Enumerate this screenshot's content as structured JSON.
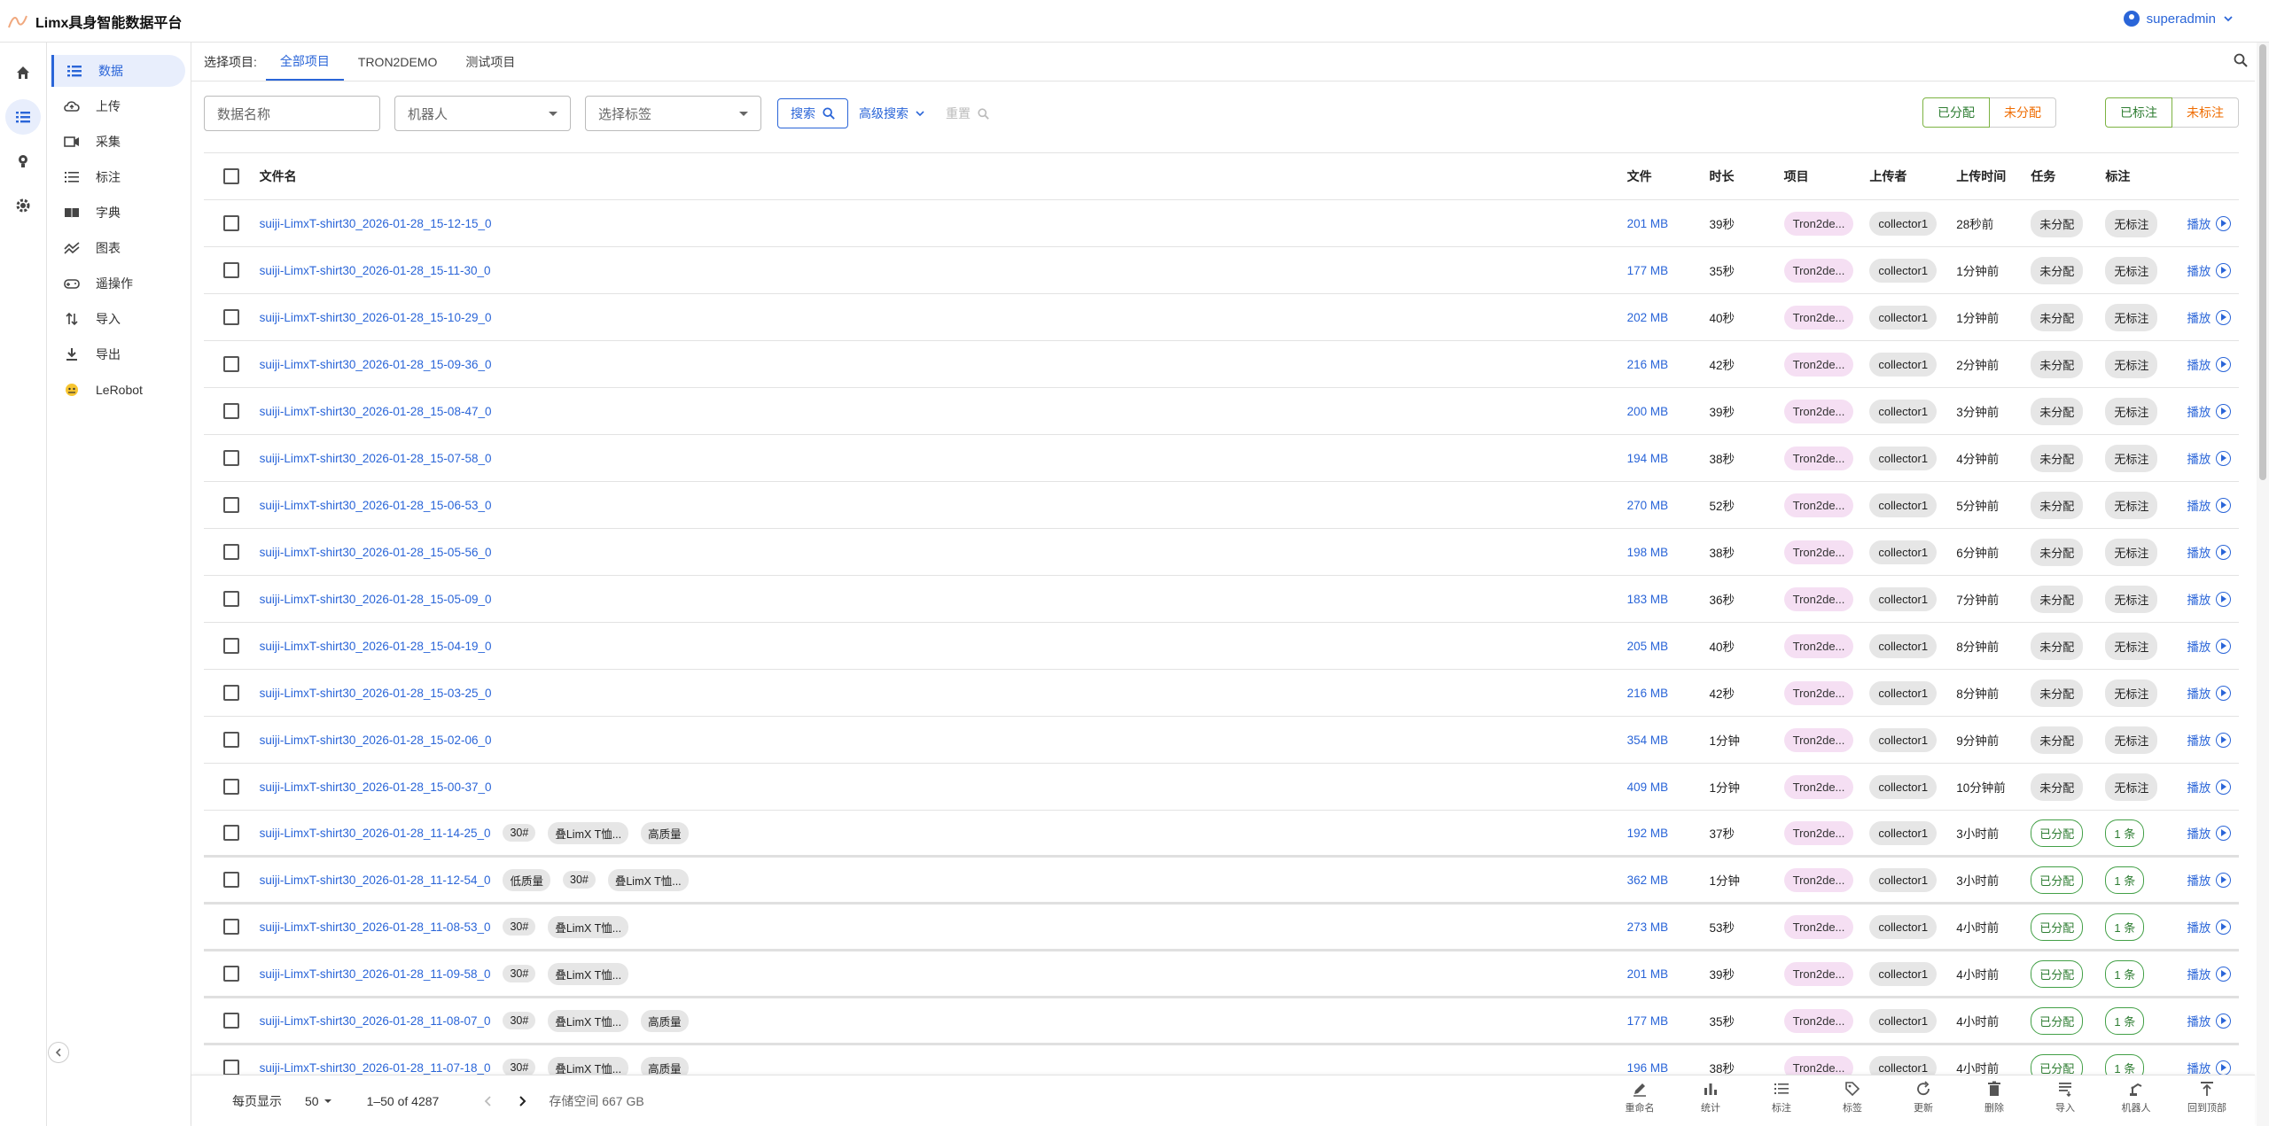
{
  "app": {
    "title": "Limx具身智能数据平台"
  },
  "user": {
    "name": "superadmin"
  },
  "colors": {
    "accent": "#2a65d8",
    "green": "#2e7d32",
    "orange": "#ef6c00",
    "chip_project": "#f5dff3"
  },
  "rail": [
    {
      "icon": "home-icon"
    },
    {
      "icon": "list-icon",
      "active": true
    },
    {
      "icon": "bulb-icon"
    },
    {
      "icon": "gear-icon"
    }
  ],
  "nav": [
    {
      "label": "数据",
      "icon": "list-icon",
      "active": true
    },
    {
      "label": "上传",
      "icon": "cloud-upload-icon"
    },
    {
      "label": "采集",
      "icon": "camera-icon"
    },
    {
      "label": "标注",
      "icon": "checklist-icon"
    },
    {
      "label": "字典",
      "icon": "book-icon"
    },
    {
      "label": "图表",
      "icon": "chart-line-icon"
    },
    {
      "label": "遥操作",
      "icon": "gamepad-icon"
    },
    {
      "label": "导入",
      "icon": "swap-vertical-icon"
    },
    {
      "label": "导出",
      "icon": "download-icon"
    },
    {
      "label": "LeRobot",
      "icon": "robot-emoji-icon"
    }
  ],
  "projects": {
    "label": "选择项目:",
    "tabs": [
      "全部项目",
      "TRON2DEMO",
      "测试项目"
    ],
    "active": 0
  },
  "filters": {
    "name_placeholder": "数据名称",
    "robot_placeholder": "机器人",
    "tag_placeholder": "选择标签",
    "search_label": "搜索",
    "advanced_label": "高级搜索",
    "reset_label": "重置",
    "assign": {
      "assigned": "已分配",
      "unassigned": "未分配"
    },
    "label": {
      "labeled": "已标注",
      "unlabeled": "未标注"
    }
  },
  "table": {
    "columns": {
      "name": "文件名",
      "size": "文件",
      "duration": "时长",
      "project": "项目",
      "uploader": "上传者",
      "time": "上传时间",
      "task": "任务",
      "label": "标注"
    },
    "play_label": "播放",
    "rows": [
      {
        "name": "suiji-LimxT-shirt30_2026-01-28_15-12-15_0",
        "tags": [],
        "size": "201 MB",
        "duration": "39秒",
        "project": "Tron2de...",
        "uploader": "collector1",
        "time": "28秒前",
        "task": "未分配",
        "label": "无标注",
        "done": false
      },
      {
        "name": "suiji-LimxT-shirt30_2026-01-28_15-11-30_0",
        "tags": [],
        "size": "177 MB",
        "duration": "35秒",
        "project": "Tron2de...",
        "uploader": "collector1",
        "time": "1分钟前",
        "task": "未分配",
        "label": "无标注",
        "done": false
      },
      {
        "name": "suiji-LimxT-shirt30_2026-01-28_15-10-29_0",
        "tags": [],
        "size": "202 MB",
        "duration": "40秒",
        "project": "Tron2de...",
        "uploader": "collector1",
        "time": "1分钟前",
        "task": "未分配",
        "label": "无标注",
        "done": false
      },
      {
        "name": "suiji-LimxT-shirt30_2026-01-28_15-09-36_0",
        "tags": [],
        "size": "216 MB",
        "duration": "42秒",
        "project": "Tron2de...",
        "uploader": "collector1",
        "time": "2分钟前",
        "task": "未分配",
        "label": "无标注",
        "done": false
      },
      {
        "name": "suiji-LimxT-shirt30_2026-01-28_15-08-47_0",
        "tags": [],
        "size": "200 MB",
        "duration": "39秒",
        "project": "Tron2de...",
        "uploader": "collector1",
        "time": "3分钟前",
        "task": "未分配",
        "label": "无标注",
        "done": false
      },
      {
        "name": "suiji-LimxT-shirt30_2026-01-28_15-07-58_0",
        "tags": [],
        "size": "194 MB",
        "duration": "38秒",
        "project": "Tron2de...",
        "uploader": "collector1",
        "time": "4分钟前",
        "task": "未分配",
        "label": "无标注",
        "done": false
      },
      {
        "name": "suiji-LimxT-shirt30_2026-01-28_15-06-53_0",
        "tags": [],
        "size": "270 MB",
        "duration": "52秒",
        "project": "Tron2de...",
        "uploader": "collector1",
        "time": "5分钟前",
        "task": "未分配",
        "label": "无标注",
        "done": false
      },
      {
        "name": "suiji-LimxT-shirt30_2026-01-28_15-05-56_0",
        "tags": [],
        "size": "198 MB",
        "duration": "38秒",
        "project": "Tron2de...",
        "uploader": "collector1",
        "time": "6分钟前",
        "task": "未分配",
        "label": "无标注",
        "done": false
      },
      {
        "name": "suiji-LimxT-shirt30_2026-01-28_15-05-09_0",
        "tags": [],
        "size": "183 MB",
        "duration": "36秒",
        "project": "Tron2de...",
        "uploader": "collector1",
        "time": "7分钟前",
        "task": "未分配",
        "label": "无标注",
        "done": false
      },
      {
        "name": "suiji-LimxT-shirt30_2026-01-28_15-04-19_0",
        "tags": [],
        "size": "205 MB",
        "duration": "40秒",
        "project": "Tron2de...",
        "uploader": "collector1",
        "time": "8分钟前",
        "task": "未分配",
        "label": "无标注",
        "done": false
      },
      {
        "name": "suiji-LimxT-shirt30_2026-01-28_15-03-25_0",
        "tags": [],
        "size": "216 MB",
        "duration": "42秒",
        "project": "Tron2de...",
        "uploader": "collector1",
        "time": "8分钟前",
        "task": "未分配",
        "label": "无标注",
        "done": false
      },
      {
        "name": "suiji-LimxT-shirt30_2026-01-28_15-02-06_0",
        "tags": [],
        "size": "354 MB",
        "duration": "1分钟",
        "project": "Tron2de...",
        "uploader": "collector1",
        "time": "9分钟前",
        "task": "未分配",
        "label": "无标注",
        "done": false
      },
      {
        "name": "suiji-LimxT-shirt30_2026-01-28_15-00-37_0",
        "tags": [],
        "size": "409 MB",
        "duration": "1分钟",
        "project": "Tron2de...",
        "uploader": "collector1",
        "time": "10分钟前",
        "task": "未分配",
        "label": "无标注",
        "done": false
      },
      {
        "name": "suiji-LimxT-shirt30_2026-01-28_11-14-25_0",
        "tags": [
          "30#",
          "叠LimX T恤...",
          "高质量"
        ],
        "size": "192 MB",
        "duration": "37秒",
        "project": "Tron2de...",
        "uploader": "collector1",
        "time": "3小时前",
        "task": "已分配",
        "label": "1 条",
        "done": true
      },
      {
        "name": "suiji-LimxT-shirt30_2026-01-28_11-12-54_0",
        "tags": [
          "低质量",
          "30#",
          "叠LimX T恤..."
        ],
        "size": "362 MB",
        "duration": "1分钟",
        "project": "Tron2de...",
        "uploader": "collector1",
        "time": "3小时前",
        "task": "已分配",
        "label": "1 条",
        "done": true
      },
      {
        "name": "suiji-LimxT-shirt30_2026-01-28_11-08-53_0",
        "tags": [
          "30#",
          "叠LimX T恤..."
        ],
        "size": "273 MB",
        "duration": "53秒",
        "project": "Tron2de...",
        "uploader": "collector1",
        "time": "4小时前",
        "task": "已分配",
        "label": "1 条",
        "done": true
      },
      {
        "name": "suiji-LimxT-shirt30_2026-01-28_11-09-58_0",
        "tags": [
          "30#",
          "叠LimX T恤..."
        ],
        "size": "201 MB",
        "duration": "39秒",
        "project": "Tron2de...",
        "uploader": "collector1",
        "time": "4小时前",
        "task": "已分配",
        "label": "1 条",
        "done": true
      },
      {
        "name": "suiji-LimxT-shirt30_2026-01-28_11-08-07_0",
        "tags": [
          "30#",
          "叠LimX T恤...",
          "高质量"
        ],
        "size": "177 MB",
        "duration": "35秒",
        "project": "Tron2de...",
        "uploader": "collector1",
        "time": "4小时前",
        "task": "已分配",
        "label": "1 条",
        "done": true
      },
      {
        "name": "suiji-LimxT-shirt30_2026-01-28_11-07-18_0",
        "tags": [
          "30#",
          "叠LimX T恤...",
          "高质量"
        ],
        "size": "196 MB",
        "duration": "38秒",
        "project": "Tron2de...",
        "uploader": "collector1",
        "time": "4小时前",
        "task": "已分配",
        "label": "1 条",
        "done": true
      }
    ]
  },
  "footer": {
    "per_page_label": "每页显示",
    "per_page_value": "50",
    "range": "1–50 of 4287",
    "storage": "存储空间 667 GB",
    "actions": [
      {
        "label": "重命名",
        "icon": "rename-icon"
      },
      {
        "label": "统计",
        "icon": "bar-chart-icon"
      },
      {
        "label": "标注",
        "icon": "checklist-icon"
      },
      {
        "label": "标签",
        "icon": "tag-icon"
      },
      {
        "label": "更新",
        "icon": "refresh-icon"
      },
      {
        "label": "删除",
        "icon": "trash-icon"
      },
      {
        "label": "导入",
        "icon": "import-icon"
      },
      {
        "label": "机器人",
        "icon": "robot-arm-icon"
      },
      {
        "label": "回到顶部",
        "icon": "to-top-icon"
      }
    ]
  }
}
